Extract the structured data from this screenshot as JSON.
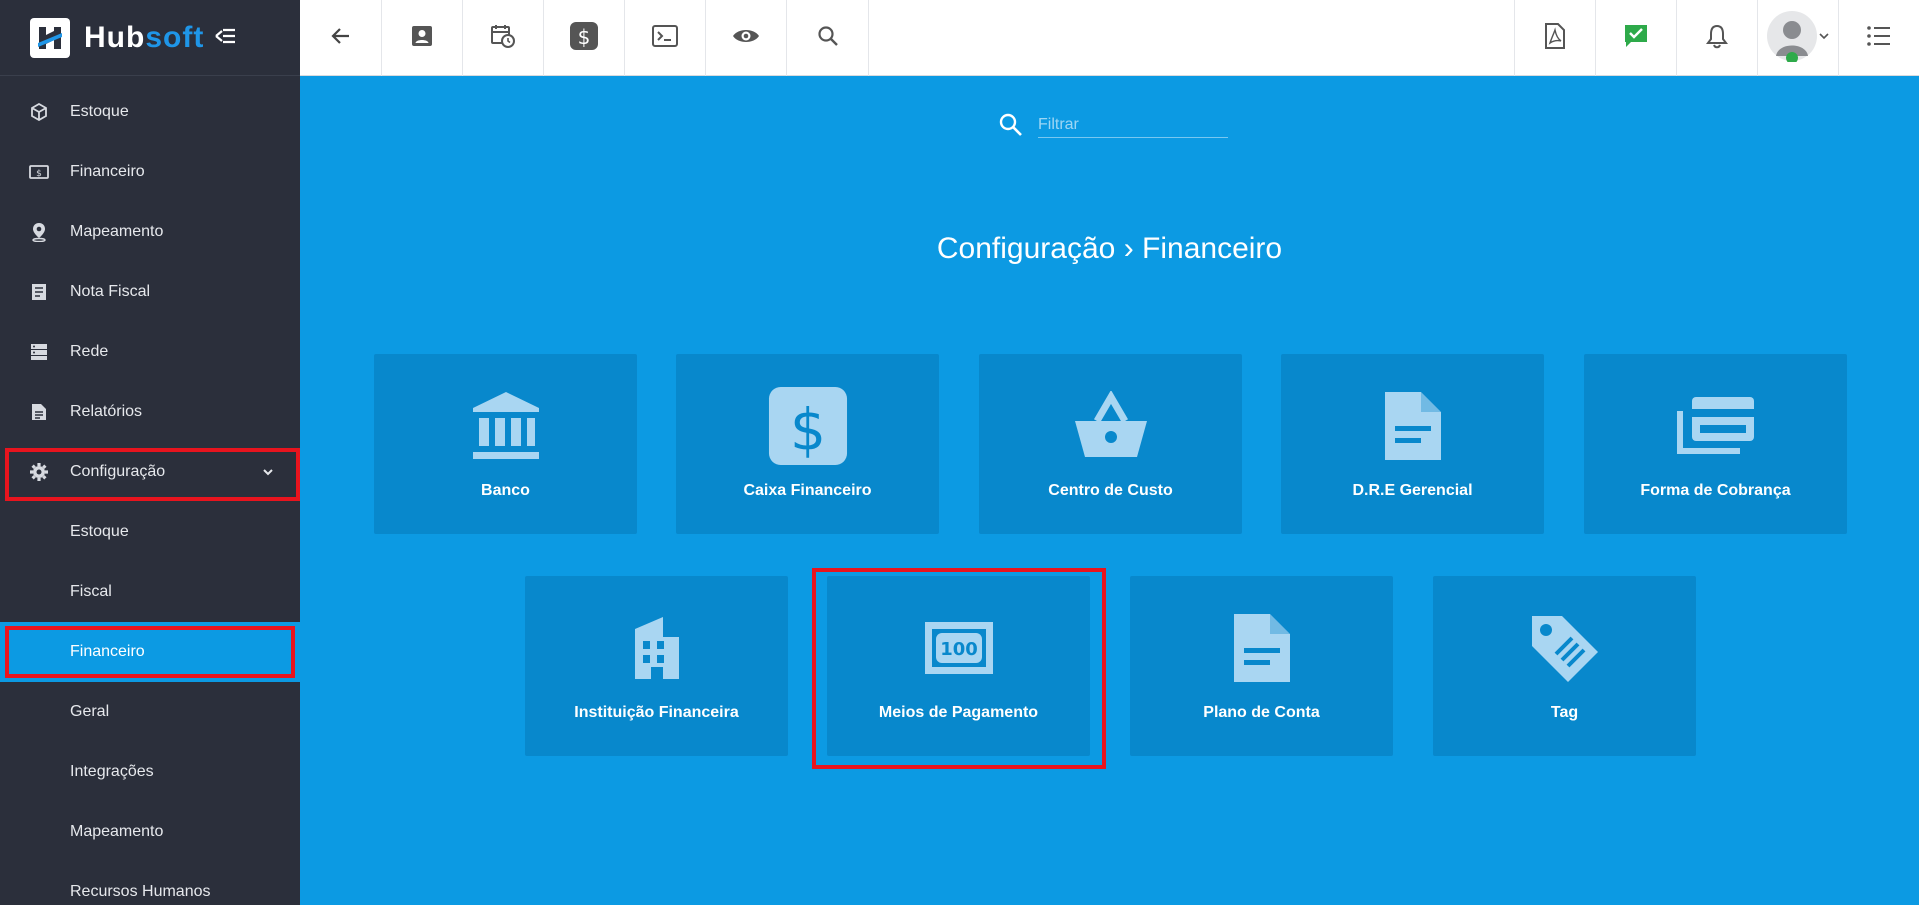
{
  "brand": {
    "name_part1": "Hub",
    "name_part2": "soft"
  },
  "sidebar": {
    "items": [
      {
        "label": "Estoque",
        "icon": "box-icon"
      },
      {
        "label": "Financeiro",
        "icon": "cash-icon"
      },
      {
        "label": "Mapeamento",
        "icon": "map-pin-icon"
      },
      {
        "label": "Nota Fiscal",
        "icon": "document-icon"
      },
      {
        "label": "Rede",
        "icon": "server-icon"
      },
      {
        "label": "Relatórios",
        "icon": "report-icon"
      },
      {
        "label": "Configuração",
        "icon": "gear-icon",
        "expanded": true
      }
    ],
    "submenu": [
      {
        "label": "Estoque"
      },
      {
        "label": "Fiscal"
      },
      {
        "label": "Financeiro",
        "active": true
      },
      {
        "label": "Geral"
      },
      {
        "label": "Integrações"
      },
      {
        "label": "Mapeamento"
      },
      {
        "label": "Recursos Humanos"
      }
    ]
  },
  "topbar": {
    "left_buttons": [
      "back-arrow-icon",
      "contact-card-icon",
      "calendar-clock-icon",
      "dollar-icon",
      "terminal-icon",
      "eye-icon",
      "search-icon"
    ],
    "right_buttons": [
      "pdf-icon",
      "check-chat-icon",
      "bell-icon",
      "avatar",
      "list-menu-icon"
    ]
  },
  "main": {
    "search": {
      "placeholder": "Filtrar"
    },
    "breadcrumb": {
      "part1": "Configuração",
      "separator": "›",
      "part2": "Financeiro"
    },
    "cards": [
      {
        "label": "Banco",
        "icon": "bank-icon"
      },
      {
        "label": "Caixa Financeiro",
        "icon": "dollar-box-icon"
      },
      {
        "label": "Centro de Custo",
        "icon": "basket-icon"
      },
      {
        "label": "D.R.E Gerencial",
        "icon": "document-icon"
      },
      {
        "label": "Forma de Cobrança",
        "icon": "cards-icon"
      },
      {
        "label": "Instituição Financeira",
        "icon": "building-icon"
      },
      {
        "label": "Meios de Pagamento",
        "icon": "banknote-100-icon",
        "badge": "100"
      },
      {
        "label": "Plano de Conta",
        "icon": "document-icon"
      },
      {
        "label": "Tag",
        "icon": "tag-icon"
      }
    ]
  },
  "colors": {
    "sidebar_bg": "#2b2f3b",
    "main_bg": "#0c9ae3",
    "card_bg": "#0888cc",
    "highlight": "#e8141e",
    "brand_accent": "#1f96e8"
  }
}
